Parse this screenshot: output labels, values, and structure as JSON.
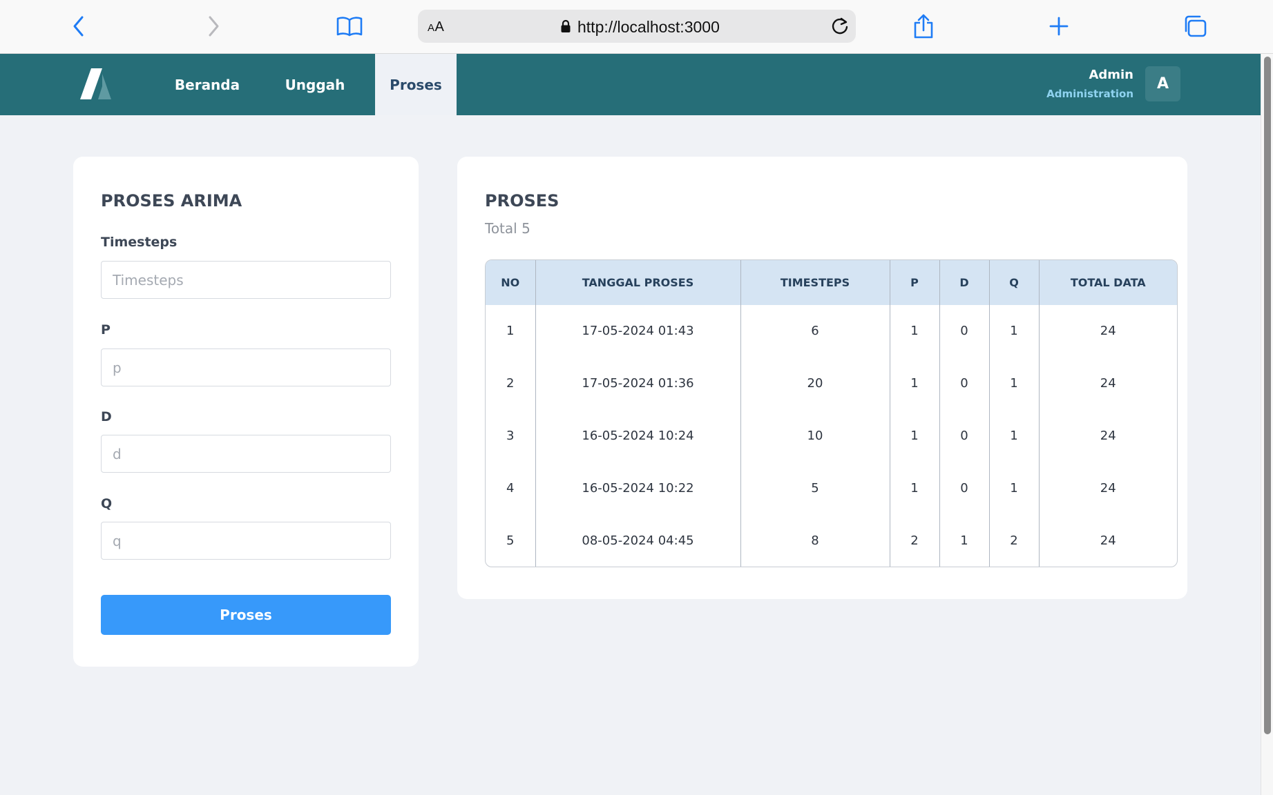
{
  "browser": {
    "text_size_label": "AA",
    "url": "http://localhost:3000"
  },
  "nav": {
    "tabs": [
      {
        "label": "Beranda"
      },
      {
        "label": "Unggah"
      },
      {
        "label": "Proses"
      }
    ],
    "active_tab": "Proses",
    "user": {
      "name": "Admin",
      "role": "Administration",
      "avatar_letter": "A"
    }
  },
  "form": {
    "title": "PROSES ARIMA",
    "fields": [
      {
        "label": "Timesteps",
        "placeholder": "Timesteps",
        "value": ""
      },
      {
        "label": "P",
        "placeholder": "p",
        "value": ""
      },
      {
        "label": "D",
        "placeholder": "d",
        "value": ""
      },
      {
        "label": "Q",
        "placeholder": "q",
        "value": ""
      }
    ],
    "submit_label": "Proses"
  },
  "results": {
    "title": "PROSES",
    "subtitle": "Total 5",
    "columns": [
      "NO",
      "TANGGAL PROSES",
      "TIMESTEPS",
      "P",
      "D",
      "Q",
      "TOTAL DATA"
    ],
    "rows": [
      [
        "1",
        "17-05-2024 01:43",
        "6",
        "1",
        "0",
        "1",
        "24"
      ],
      [
        "2",
        "17-05-2024 01:36",
        "20",
        "1",
        "0",
        "1",
        "24"
      ],
      [
        "3",
        "16-05-2024 10:24",
        "10",
        "1",
        "0",
        "1",
        "24"
      ],
      [
        "4",
        "16-05-2024 10:22",
        "5",
        "1",
        "0",
        "1",
        "24"
      ],
      [
        "5",
        "08-05-2024 04:45",
        "8",
        "2",
        "1",
        "2",
        "24"
      ]
    ]
  },
  "colors": {
    "nav_bg": "#266e78",
    "accent_button": "#3799fa",
    "table_header_bg": "#d5e4f3",
    "page_bg": "#f0f2f6",
    "browser_icon_blue": "#1f7cf5"
  },
  "icons": {
    "browser": [
      "back-icon",
      "forward-icon",
      "bookmarks-icon",
      "lock-icon",
      "reload-icon",
      "share-icon",
      "new-tab-icon",
      "tabs-icon"
    ]
  }
}
